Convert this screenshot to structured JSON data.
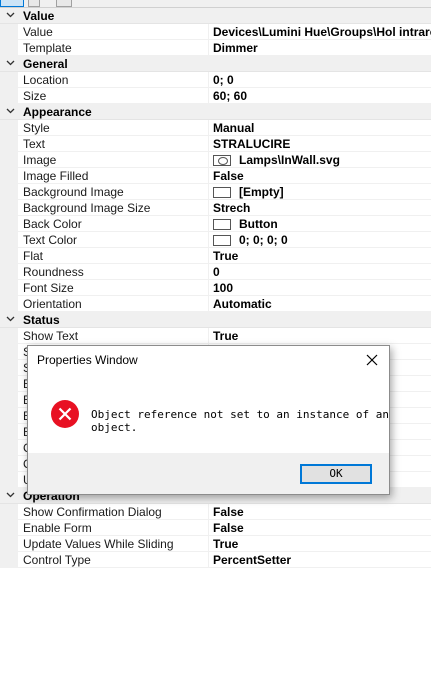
{
  "grid": {
    "categories": [
      {
        "name": "Value",
        "props": [
          {
            "name": "Value",
            "value": "Devices\\Lumini Hue\\Groups\\Hol intrare"
          },
          {
            "name": "Template",
            "value": "Dimmer"
          }
        ]
      },
      {
        "name": "General",
        "props": [
          {
            "name": "Location",
            "value": "0; 0"
          },
          {
            "name": "Size",
            "value": "60; 60"
          }
        ]
      },
      {
        "name": "Appearance",
        "props": [
          {
            "name": "Style",
            "value": "Manual"
          },
          {
            "name": "Text",
            "value": "STRALUCIRE"
          },
          {
            "name": "Image",
            "value": "Lamps\\InWall.svg",
            "icon": "image-icon"
          },
          {
            "name": "Image Filled",
            "value": "False"
          },
          {
            "name": "Background Image",
            "value": "[Empty]",
            "icon": "swatch"
          },
          {
            "name": "Background Image Size",
            "value": "Strech"
          },
          {
            "name": "Back Color",
            "value": "Button",
            "icon": "swatch"
          },
          {
            "name": "Text Color",
            "value": "0; 0; 0; 0",
            "icon": "swatch"
          },
          {
            "name": "Flat",
            "value": "True"
          },
          {
            "name": "Roundness",
            "value": "0"
          },
          {
            "name": "Font Size",
            "value": "100"
          },
          {
            "name": "Orientation",
            "value": "Automatic"
          }
        ]
      },
      {
        "name": "Status",
        "props": [
          {
            "name": "Show Text",
            "value": "True"
          },
          {
            "name": "S",
            "value": ""
          },
          {
            "name": "S",
            "value": ""
          },
          {
            "name": "E",
            "value": ""
          },
          {
            "name": "E",
            "value": ""
          },
          {
            "name": "E",
            "value": ""
          },
          {
            "name": "E",
            "value": ""
          },
          {
            "name": "C",
            "value": ""
          },
          {
            "name": "C",
            "value": ""
          },
          {
            "name": "U",
            "value": ""
          }
        ]
      },
      {
        "name": "Operation",
        "props": [
          {
            "name": "Show Confirmation Dialog",
            "value": "False"
          },
          {
            "name": "Enable Form",
            "value": "False"
          },
          {
            "name": "Update Values While Sliding",
            "value": "True"
          },
          {
            "name": "Control Type",
            "value": "PercentSetter"
          }
        ]
      }
    ]
  },
  "dialog": {
    "title": "Properties Window",
    "message": "Object reference not set to an instance of an object.",
    "ok_label": "OK",
    "icon": "error-icon",
    "colors": {
      "error": "#e81123",
      "focus": "#0078d7"
    }
  }
}
